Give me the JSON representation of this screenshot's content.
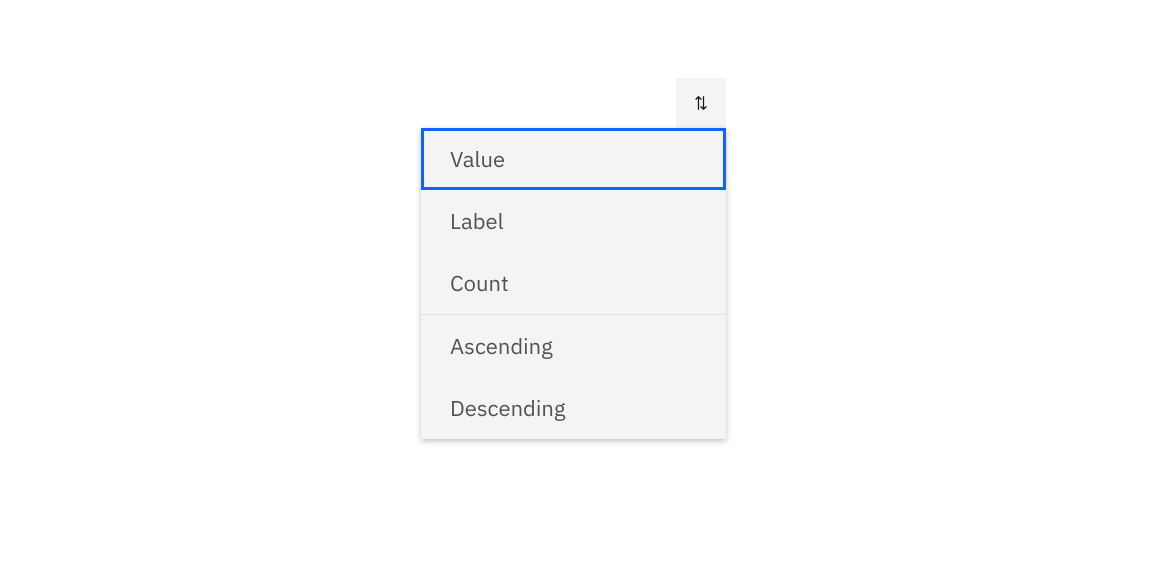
{
  "sort": {
    "icon_name": "sort-icon",
    "sort_by_options": [
      {
        "label": "Value",
        "selected": true
      },
      {
        "label": "Label",
        "selected": false
      },
      {
        "label": "Count",
        "selected": false
      }
    ],
    "order_options": [
      {
        "label": "Ascending",
        "selected": false
      },
      {
        "label": "Descending",
        "selected": false
      }
    ]
  },
  "colors": {
    "focus": "#0f62fe",
    "panel_bg": "#f4f4f4",
    "text": "#525252",
    "divider": "#e0e0e0"
  }
}
